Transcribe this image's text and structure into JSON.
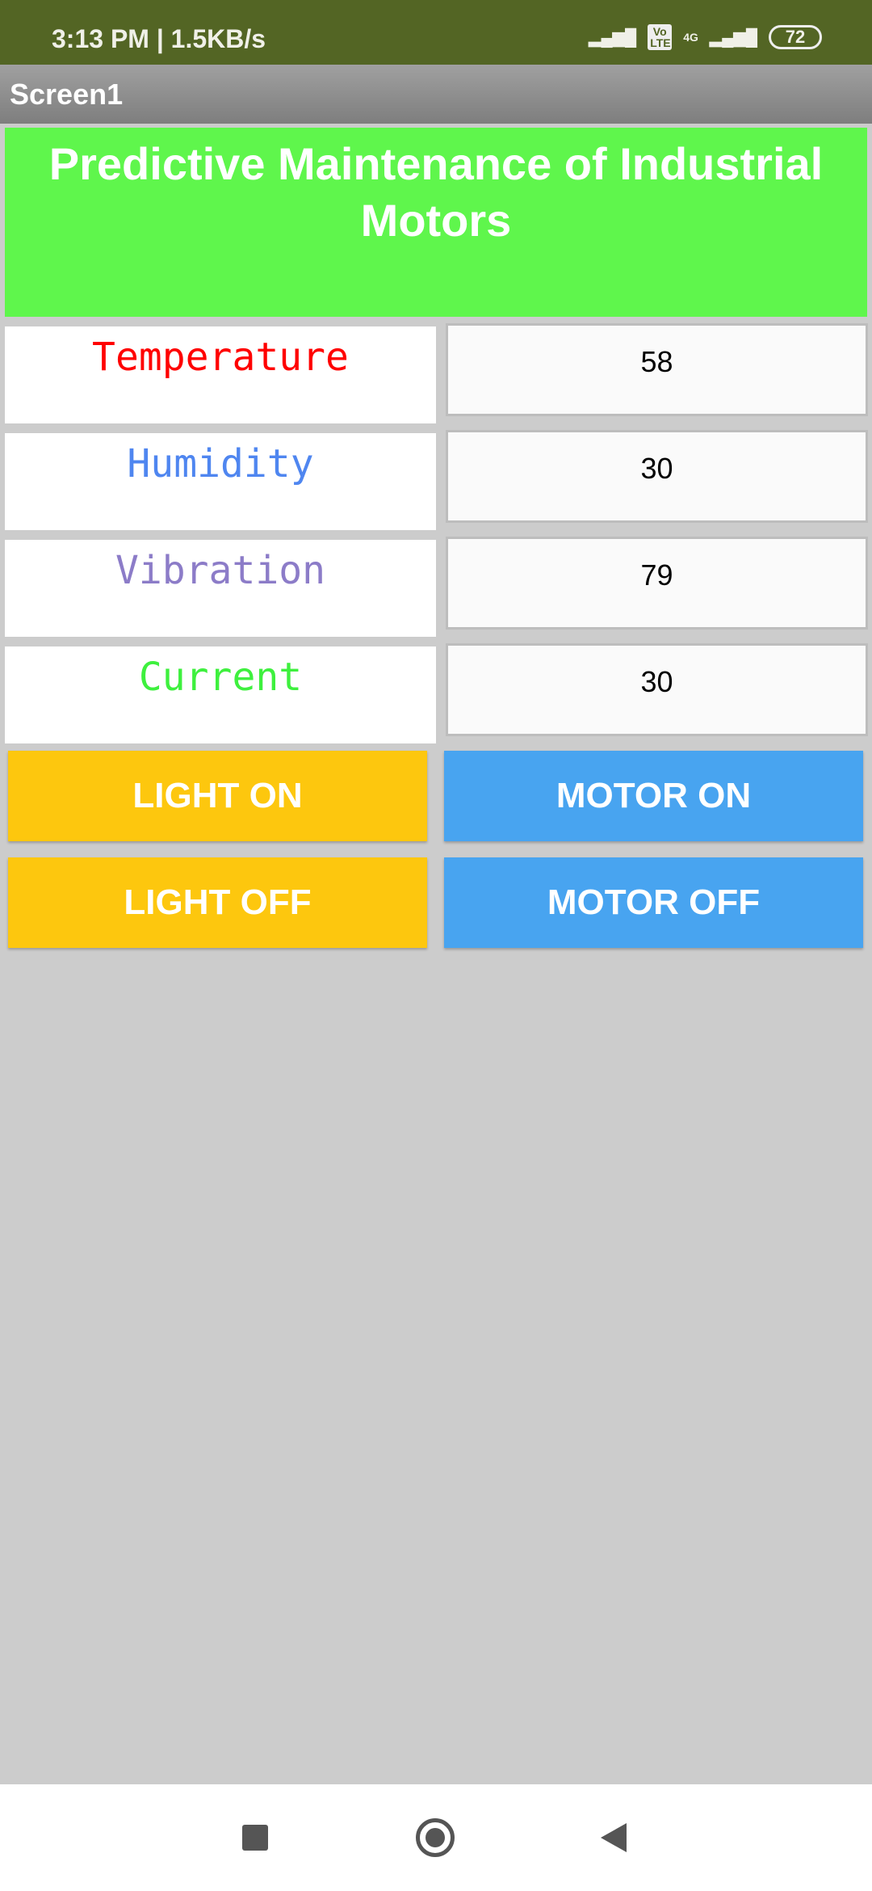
{
  "status_bar": {
    "time": "3:13 PM | 1.5KB/s",
    "network_label": "4G",
    "volte": "Vo LTE",
    "battery": "72"
  },
  "app": {
    "screen_title": "Screen1",
    "header_title": "Predictive Maintenance of Industrial Motors"
  },
  "readings": [
    {
      "label": "Temperature",
      "value": "58",
      "color": "#ff0000"
    },
    {
      "label": "Humidity",
      "value": "30",
      "color": "#4f86f0"
    },
    {
      "label": "Vibration",
      "value": "79",
      "color": "#8c7cc8"
    },
    {
      "label": "Current",
      "value": "30",
      "color": "#3ef03e"
    }
  ],
  "buttons": {
    "light_on": "LIGHT ON",
    "motor_on": "MOTOR ON",
    "light_off": "LIGHT OFF",
    "motor_off": "MOTOR OFF",
    "light_color": "#fdc70e",
    "motor_color": "#48a4f0"
  }
}
